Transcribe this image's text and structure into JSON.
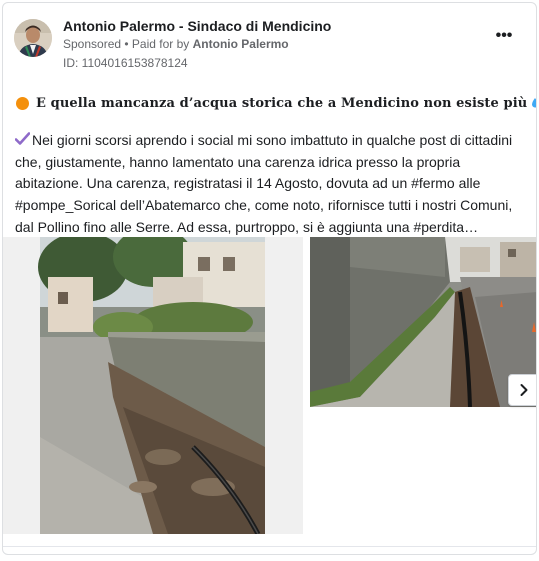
{
  "post": {
    "page_name": "Antonio Palermo - Sindaco di Mendicino",
    "sponsored_label": "Sponsored",
    "separator": " • ",
    "paid_for_label": "Paid for by ",
    "paid_for_name": "Antonio Palermo",
    "ad_id": "ID: 1104016153878124",
    "more_label": "•••",
    "headline": "E quella mancanza d’acqua storica che a Mendicino non esiste più",
    "body_lines": [
      "Nei giorni scorsi aprendo i social mi sono imbattuto in qualche post di cittadini",
      "che, giustamente, hanno lamentato una carenza idrica presso la propria",
      "abitazione. Una carenza, registratasi il 14 Agosto, dovuta ad un #fermo alle",
      "#pompe_Sorical dell’Abatemarco che, come noto, rifornisce tutti i nostri Comuni,",
      "dal Pollino fino alle Serre. Ad essa, purtroppo, si è aggiunta una #perdita…"
    ]
  },
  "icons": {
    "headline_dot": "orange-circle-icon",
    "headline_end": "sweat-droplets-icon",
    "body_start": "check-mark-icon",
    "more": "more-options-icon",
    "carousel_next": "chevron-right-icon"
  },
  "colors": {
    "text": "#1c1e21",
    "secondary": "#65676b",
    "border": "#dddfe2",
    "orange": "#f4900c",
    "check_purple": "#8e6ac9",
    "droplets": "#3fa9f5"
  }
}
